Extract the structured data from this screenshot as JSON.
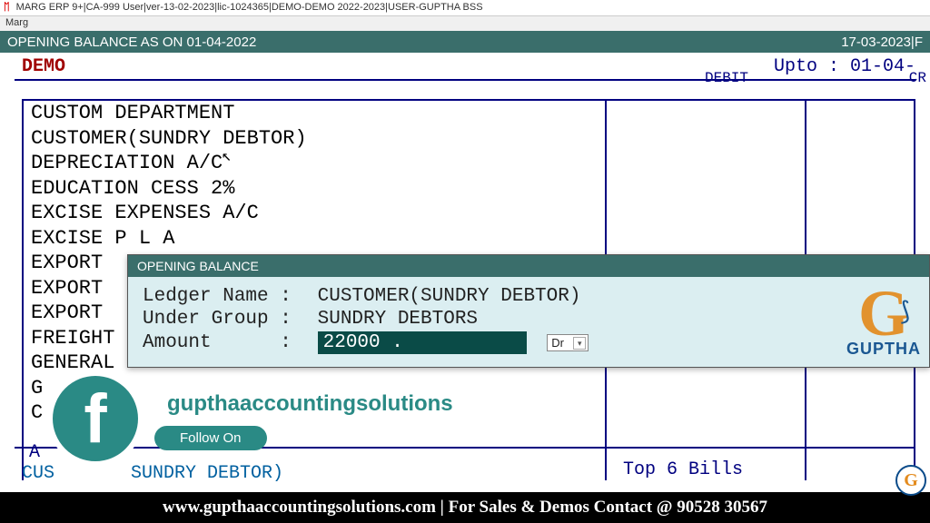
{
  "window": {
    "title": "MARG ERP 9+|CA-999 User|ver-13-02-2023|lic-1024365|DEMO-DEMO 2022-2023|USER-GUPTHA BSS",
    "menu": "Marg"
  },
  "header": {
    "title": "OPENING BALANCE AS ON 01-04-2022",
    "right": "17-03-2023|F"
  },
  "company": {
    "name": "DEMO",
    "upto": "Upto : 01-04-",
    "debit": "DEBIT",
    "credit": "CR"
  },
  "ledgers": [
    "CUSTOM DEPARTMENT",
    "CUSTOMER(SUNDRY DEBTOR)",
    "DEPRECIATION A/C",
    "EDUCATION CESS 2%",
    "EXCISE EXPENSES A/C",
    "EXCISE P L A",
    "EXPORT",
    "EXPORT",
    "EXPORT",
    "FREIGHT",
    "GENERAL",
    "G",
    "C"
  ],
  "selected": {
    "prefix": "A",
    "name": "SUNDRY DEBTOR)"
  },
  "top_bills": "Top 6 Bills",
  "dialog": {
    "title": "OPENING BALANCE",
    "ledger_label": "Ledger Name",
    "ledger_value": "CUSTOMER(SUNDRY DEBTOR)",
    "group_label": "Under Group",
    "group_value": "SUNDRY DEBTORS",
    "amount_label": "Amount",
    "amount_value": "22000       .",
    "drcr": "Dr"
  },
  "overlay": {
    "handle": "gupthaaccountingsolutions",
    "follow": "Follow On"
  },
  "brand": {
    "name": "GUPTHA"
  },
  "footer": "www.gupthaaccountingsolutions.com | For Sales & Demos Contact @ 90528 30567"
}
